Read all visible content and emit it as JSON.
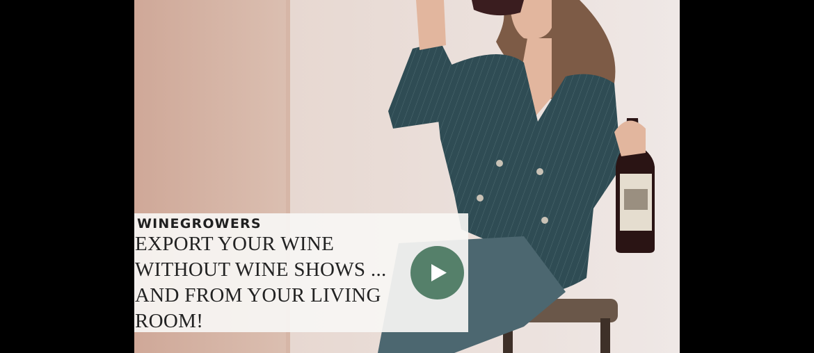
{
  "video": {
    "brand": "WINEGROWERS",
    "headline_lines": [
      "EXPORT YOUR WINE",
      "WITHOUT WINE SHOWS ...",
      "AND FROM YOUR LIVING",
      "ROOM!"
    ],
    "play_icon": "play-icon"
  },
  "colors": {
    "background": "#000000",
    "play_button": "#55806a",
    "card": "#f7f6f4",
    "suit": "#2e4a52"
  }
}
